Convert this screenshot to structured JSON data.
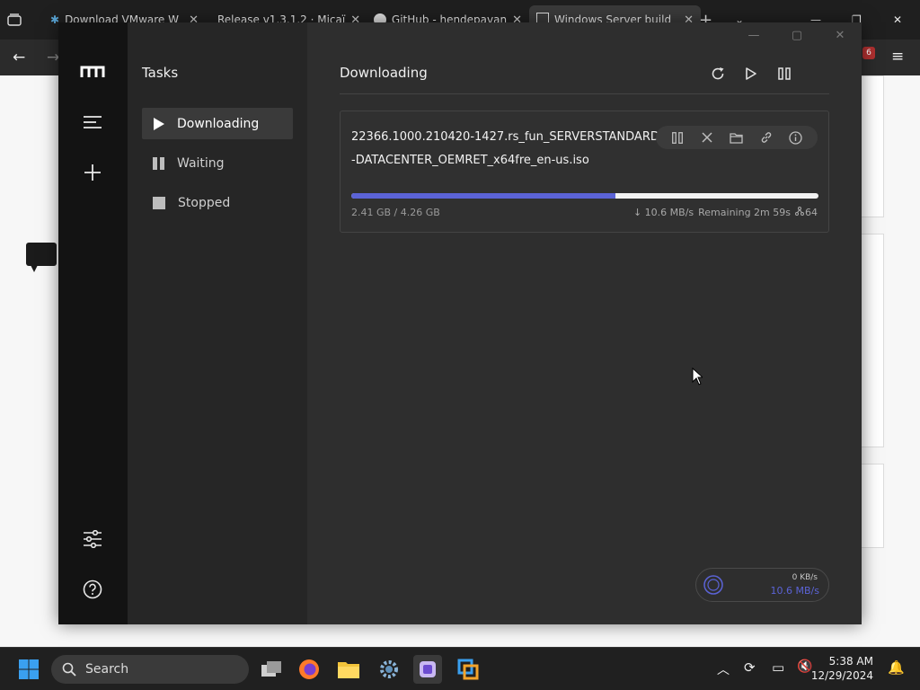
{
  "browser": {
    "tabs": [
      {
        "label": "Download VMware W"
      },
      {
        "label": "Release v1.3.1.2 · Micaï"
      },
      {
        "label": "GitHub - hendepavan"
      },
      {
        "label": "Windows Server build"
      }
    ],
    "notification_count": "6"
  },
  "app": {
    "sidebar_title": "Tasks",
    "nav": [
      {
        "label": "Downloading"
      },
      {
        "label": "Waiting"
      },
      {
        "label": "Stopped"
      }
    ],
    "main_heading": "Downloading",
    "task": {
      "filename_line1": "22366.1000.210420-1427.rs_fun_SERVERSTANDARD",
      "filename_line2": "-DATACENTER_OEMRET_x64fre_en-us.iso",
      "progress_fraction": 0.566,
      "sizes": "2.41 GB / 4.26 GB",
      "speed": "↓ 10.6 MB/s",
      "remaining": "Remaining 2m 59s",
      "connections": "64"
    },
    "speedometer": {
      "upload": "0 KB/s",
      "download": "10.6 MB/s"
    }
  },
  "taskbar": {
    "search_label": "Search",
    "time": "5:38 AM",
    "date": "12/29/2024"
  },
  "colors": {
    "accent": "#5b63d6"
  }
}
